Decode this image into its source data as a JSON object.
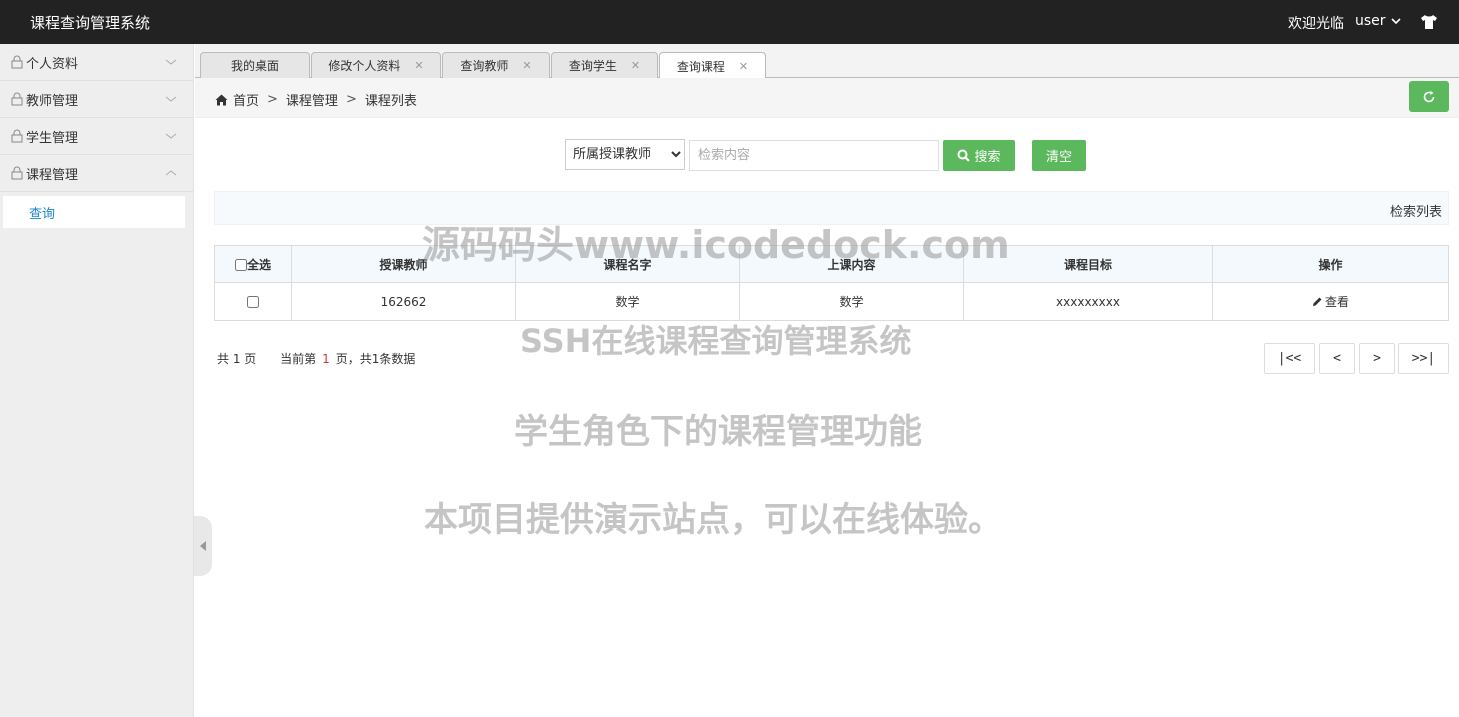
{
  "header": {
    "title": "课程查询管理系统",
    "welcome": "欢迎光临",
    "user": "user"
  },
  "sidebar": {
    "groups": [
      {
        "label": "个人资料"
      },
      {
        "label": "教师管理"
      },
      {
        "label": "学生管理"
      },
      {
        "label": "课程管理"
      }
    ],
    "active_sub": "查询"
  },
  "tabs": [
    {
      "label": "我的桌面"
    },
    {
      "label": "修改个人资料"
    },
    {
      "label": "查询教师"
    },
    {
      "label": "查询学生"
    },
    {
      "label": "查询课程"
    }
  ],
  "breadcrumb": {
    "home": "首页",
    "level1": "课程管理",
    "level2": "课程列表",
    "sep": ">"
  },
  "search": {
    "select_value": "所属授课教师",
    "placeholder": "检索内容",
    "search_label": "搜索",
    "clear_label": "清空"
  },
  "list": {
    "title": "检索列表",
    "columns": [
      "全选",
      "授课教师",
      "课程名字",
      "上课内容",
      "课程目标",
      "操作"
    ],
    "rows": [
      {
        "teacher": "162662",
        "course": "数学",
        "content": "数学",
        "goal": "xxxxxxxxx",
        "action": "查看"
      }
    ]
  },
  "pagination": {
    "total_pages_text": "共 1 页",
    "current_prefix": "当前第",
    "current": "1",
    "current_suffix": "页，共1条数据",
    "first": "|<<",
    "prev": "<",
    "next": ">",
    "last": ">>|"
  },
  "watermark": {
    "line1": "源码码头www.icodedock.com",
    "line2": "SSH在线课程查询管理系统",
    "line3": "学生角色下的课程管理功能",
    "line4": "本项目提供演示站点，可以在线体验。"
  },
  "colors": {
    "header_bg": "#222222",
    "accent_green": "#5cb85c",
    "link_blue": "#1e87c8"
  }
}
